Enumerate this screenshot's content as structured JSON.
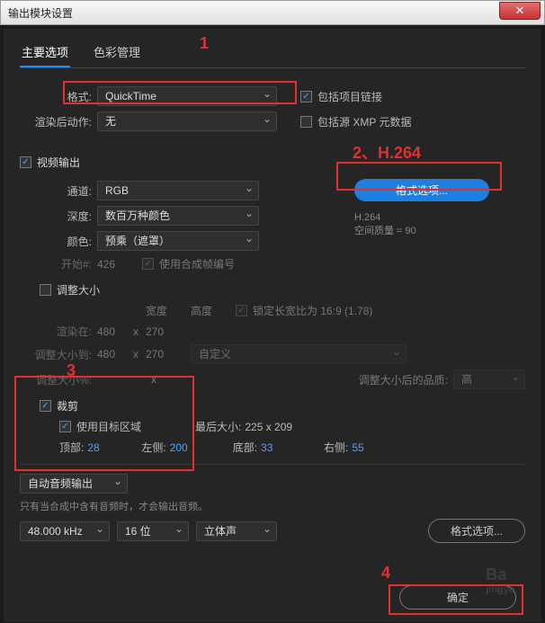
{
  "window": {
    "title": "输出模块设置",
    "close_glyph": "✕"
  },
  "tabs": {
    "main": "主要选项",
    "color": "色彩管理"
  },
  "annotations": {
    "one": "1",
    "two": "2、H.264",
    "three": "3",
    "four": "4"
  },
  "format": {
    "label": "格式:",
    "value": "QuickTime",
    "post_label": "渲染后动作:",
    "post_value": "无",
    "include_link": "包括项目链接",
    "include_xmp": "包括源 XMP 元数据"
  },
  "video": {
    "header": "视频输出",
    "channel_label": "通道:",
    "channel_value": "RGB",
    "depth_label": "深度:",
    "depth_value": "数百万种颜色",
    "color_label": "颜色:",
    "color_value": "预乘（遮罩）",
    "start_label": "开始#:",
    "start_value": "426",
    "use_comp_frame": "使用合成帧编号",
    "format_options_btn": "格式选项...",
    "codec": "H.264",
    "quality": "空间质量 = 90"
  },
  "resize": {
    "header": "调整大小",
    "width": "宽度",
    "height": "高度",
    "lock_aspect": "锁定长宽比为 16:9 (1.78)",
    "render_at": "渲染在:",
    "rw": "480",
    "rh": "270",
    "resize_to": "调整大小到:",
    "tw": "480",
    "th": "270",
    "custom": "自定义",
    "resize_pct": "调整大小%:",
    "after_quality_label": "调整大小后的品质:",
    "after_quality_value": "高"
  },
  "crop": {
    "header": "裁剪",
    "use_roi": "使用目标区域",
    "final_size_label": "最后大小:",
    "final_size_value": "225 x 209",
    "top_label": "顶部:",
    "top": "28",
    "left_label": "左侧:",
    "left": "200",
    "bottom_label": "底部:",
    "bottom": "33",
    "right_label": "右侧:",
    "right": "55"
  },
  "audio": {
    "mode": "自动音频输出",
    "hint": "只有当合成中含有音频时，才会输出音频。",
    "rate": "48.000 kHz",
    "bits": "16 位",
    "channels": "立体声",
    "format_options_btn": "格式选项..."
  },
  "footer": {
    "ok": "确定"
  },
  "watermark": {
    "brand": "Ba",
    "name": "jingye"
  }
}
